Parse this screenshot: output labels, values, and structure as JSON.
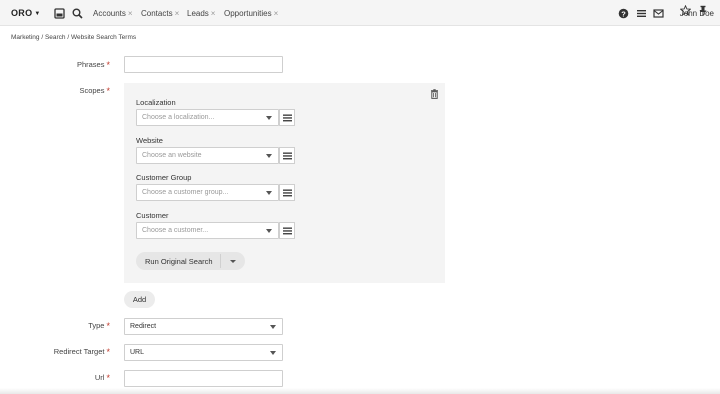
{
  "topbar": {
    "logo": "ORO",
    "tabs": [
      {
        "label": "Accounts"
      },
      {
        "label": "Contacts"
      },
      {
        "label": "Leads"
      },
      {
        "label": "Opportunities"
      }
    ],
    "close_glyph": "×",
    "user": "John Doe",
    "icons": [
      "dashboard-icon",
      "search-icon",
      "help-icon",
      "menu-icon",
      "mail-icon"
    ]
  },
  "breadcrumb": "Marketing / Search / Website Search Terms",
  "form": {
    "phrases_label": "Phrases",
    "phrases_value": "",
    "scopes_label": "Scopes",
    "scopes": [
      {
        "label": "Localization",
        "placeholder": "Choose a localization..."
      },
      {
        "label": "Website",
        "placeholder": "Choose an website"
      },
      {
        "label": "Customer Group",
        "placeholder": "Choose a customer group..."
      },
      {
        "label": "Customer",
        "placeholder": "Choose a customer..."
      }
    ],
    "run_original_search": "Run Original Search",
    "add_label": "Add",
    "type_label": "Type",
    "type_value": "Redirect",
    "redirect_target_label": "Redirect Target",
    "redirect_target_value": "URL",
    "url_label": "Url",
    "url_value": "",
    "required_mark": "*"
  }
}
